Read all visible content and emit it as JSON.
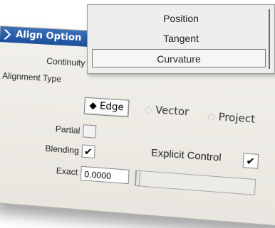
{
  "dialog": {
    "title": "Align Option",
    "continuity_label": "Continuity",
    "alignment_type_label": "Alignment Type",
    "alignment_options": {
      "edge": "Edge",
      "vector": "Vector",
      "project": "Project",
      "selected": "Edge"
    },
    "partial_label": "Partial",
    "partial_checked": false,
    "blending_label": "Blending",
    "blending_checked": true,
    "explicit_control_label": "Explicit Control",
    "explicit_control_checked": true,
    "exact_label": "Exact",
    "exact_value": "0.0000"
  },
  "continuity_menu": {
    "items": [
      "Position",
      "Tangent",
      "Curvature"
    ],
    "selected": "Curvature"
  },
  "icons": {
    "title_icon": "chevron-right-icon",
    "check_icon": "checkmark-icon",
    "selected_diamond": "diamond-filled-icon",
    "unselected_diamond": "diamond-outline-icon"
  },
  "colors": {
    "title_bar": "#1c4f9b",
    "dialog_bg": "#eeece6"
  }
}
